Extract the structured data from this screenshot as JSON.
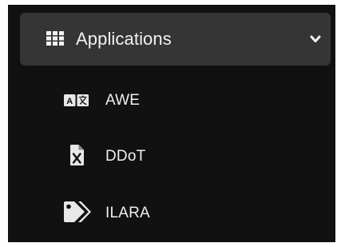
{
  "menu": {
    "section": {
      "title": "Applications",
      "icon": "grid-icon",
      "expanded": true,
      "toggle_icon": "chevron-down-icon"
    },
    "items": [
      {
        "label": "AWE",
        "icon": "translate-icon"
      },
      {
        "label": "DDoT",
        "icon": "excel-file-icon"
      },
      {
        "label": "ILARA",
        "icon": "tags-icon"
      }
    ]
  },
  "colors": {
    "panel_background": "#111111",
    "header_background": "#353535",
    "text": "#f0f0f0"
  }
}
